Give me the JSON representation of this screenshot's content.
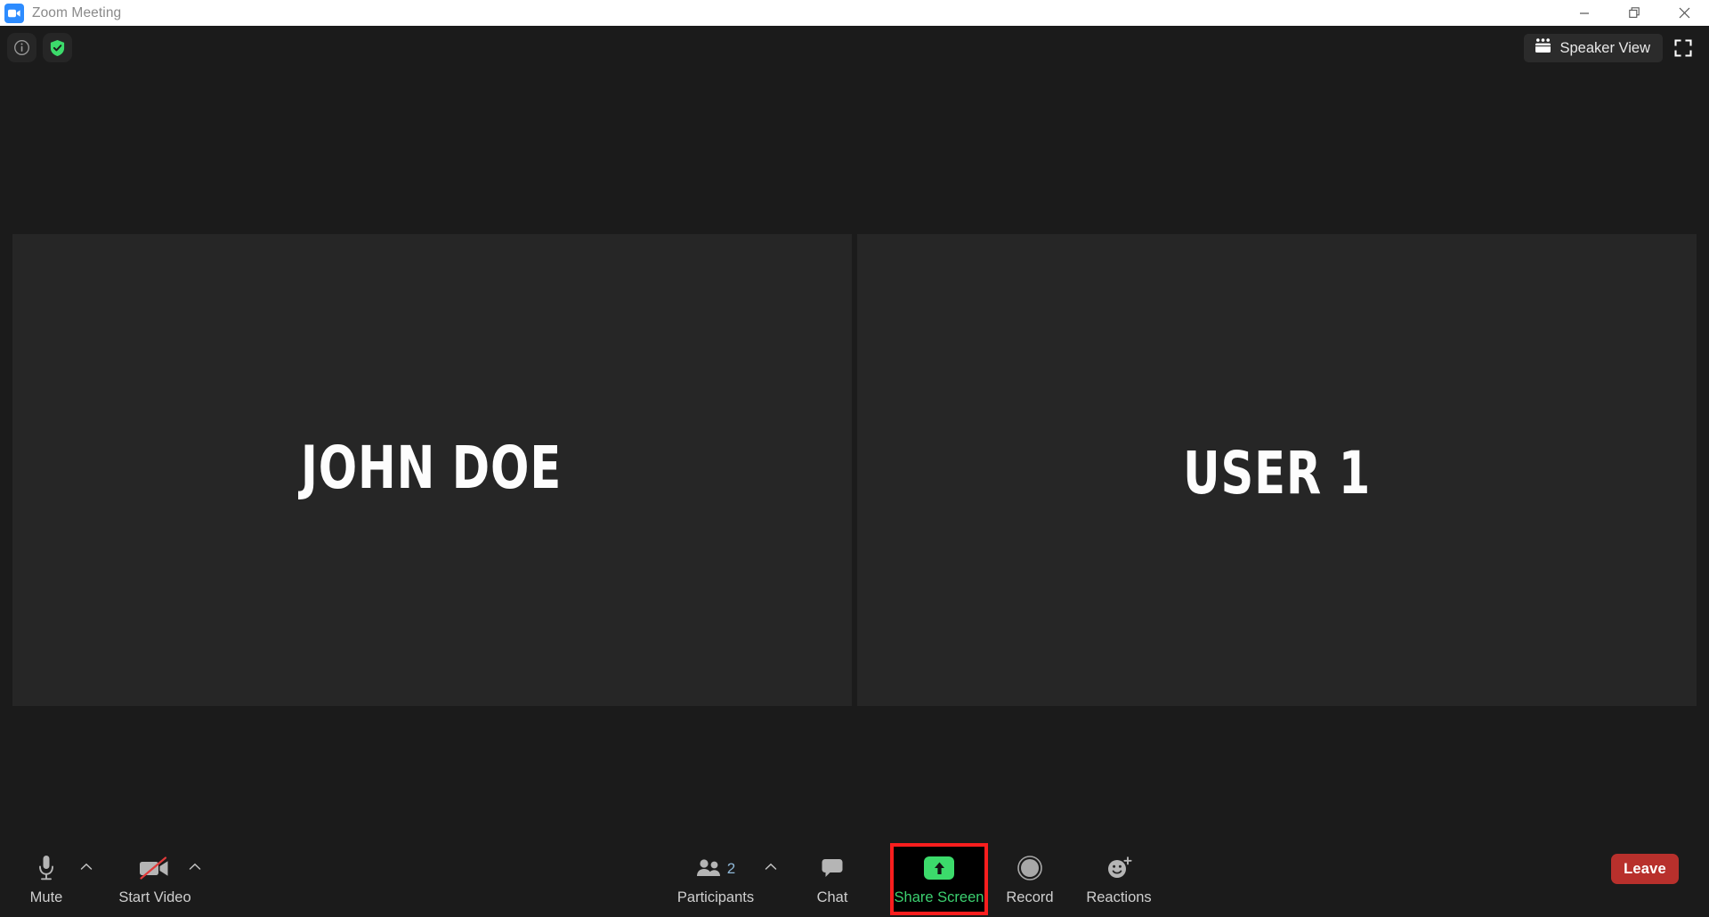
{
  "window": {
    "title": "Zoom Meeting",
    "app_icon": "zoom-video-icon",
    "controls": [
      {
        "name": "minimize",
        "glyph": "minimize-icon"
      },
      {
        "name": "restore",
        "glyph": "restore-icon"
      },
      {
        "name": "close",
        "glyph": "close-icon"
      }
    ]
  },
  "top_bar": {
    "left_icons": [
      {
        "name": "meeting-info",
        "icon": "info-circle-icon"
      },
      {
        "name": "encryption-status",
        "icon": "shield-check-icon",
        "color": "#3cdb6b"
      }
    ],
    "view_button": {
      "label": "Speaker View",
      "icon": "gallery-view-icon"
    },
    "fullscreen_button": {
      "icon": "fullscreen-expand-icon"
    }
  },
  "stage": {
    "participants": [
      {
        "name": "JOHN DOE"
      },
      {
        "name": "USER 1"
      }
    ]
  },
  "toolbar": {
    "mute": {
      "label": "Mute",
      "icon": "microphone-icon",
      "has_chevron": true
    },
    "video": {
      "label": "Start Video",
      "icon": "video-off-icon",
      "has_chevron": true
    },
    "participants": {
      "label": "Participants",
      "icon": "people-icon",
      "count": "2",
      "has_chevron": true
    },
    "chat": {
      "label": "Chat",
      "icon": "chat-bubble-icon"
    },
    "share": {
      "label": "Share Screen",
      "icon": "share-arrow-up-icon",
      "highlighted": true,
      "accent": "#3cdb6b"
    },
    "record": {
      "label": "Record",
      "icon": "record-circle-icon"
    },
    "reactions": {
      "label": "Reactions",
      "icon": "smiley-plus-icon"
    },
    "leave": {
      "label": "Leave",
      "color": "#b8302c"
    }
  }
}
